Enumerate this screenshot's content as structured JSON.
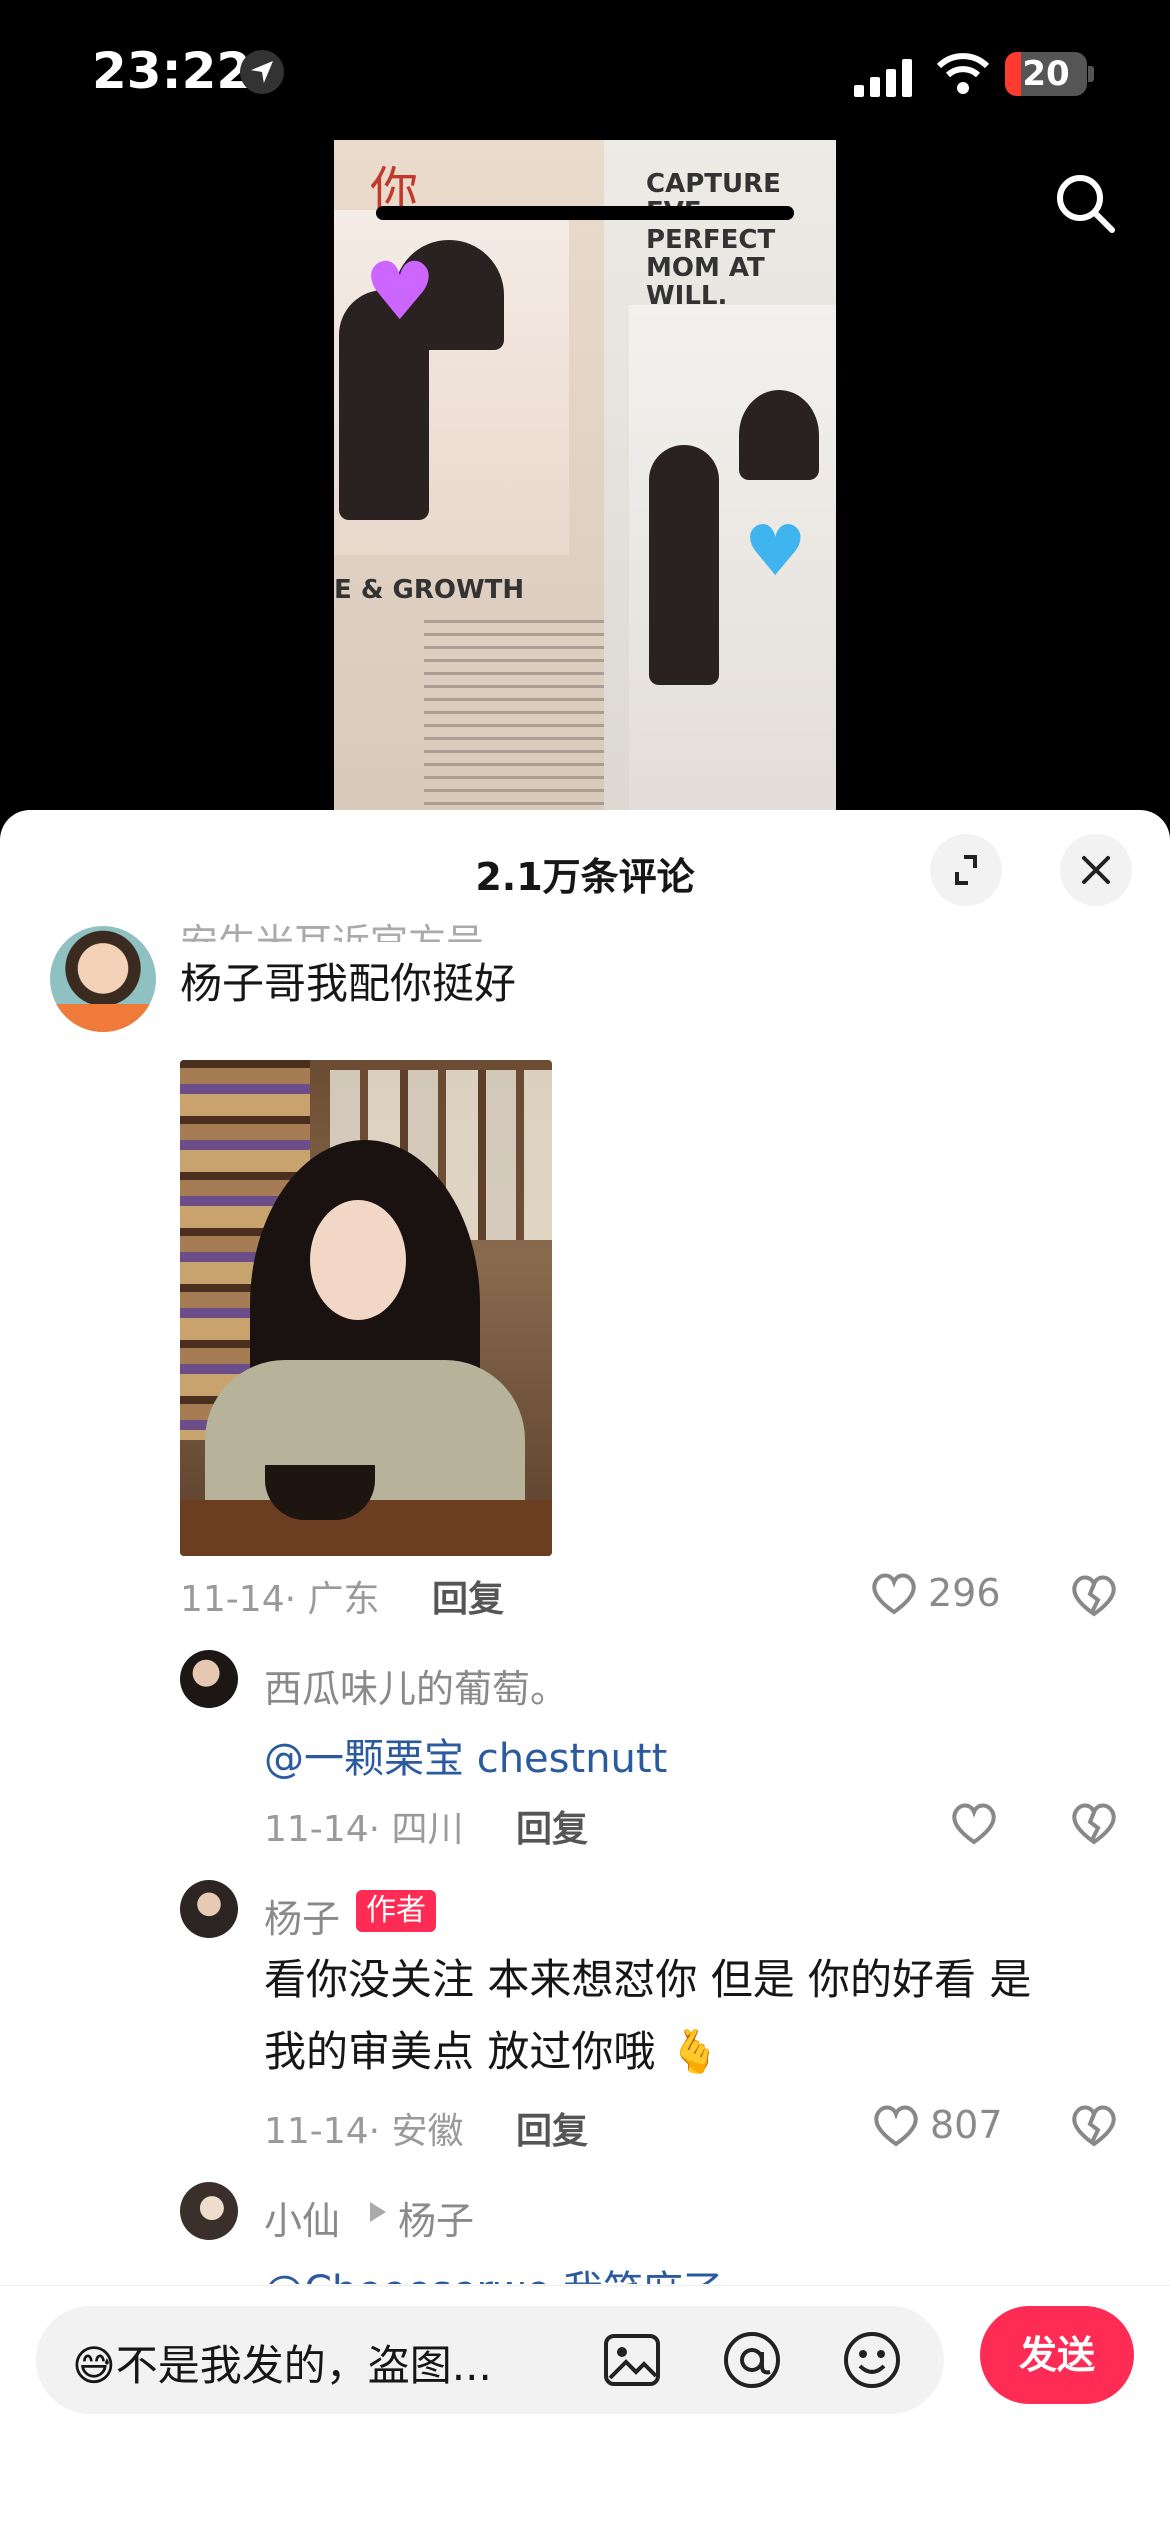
{
  "status_bar": {
    "time": "23:22",
    "battery": "20"
  },
  "video": {
    "text_right": "CAPTURE EVE PERFECT MOM AT WILL.",
    "text_left": "E & GROWTH",
    "text_top": "你"
  },
  "comments_sheet": {
    "title": "2.1万条评论",
    "main_comment": {
      "username_partial": "安生米耳近官方号",
      "text": "杨子哥我配你挺好",
      "date": "11-14",
      "location": "广东",
      "reply_label": "回复",
      "likes": "296"
    },
    "replies": [
      {
        "username": "西瓜味儿的葡萄。",
        "mention": "@一颗栗宝 chestnutt",
        "date": "11-14",
        "location": "四川",
        "reply_label": "回复",
        "likes": ""
      },
      {
        "username": "杨子",
        "badge": "作者",
        "text_line1": "看你没关注 本来想怼你 但是 你的好看 是",
        "text_line2": "我的审美点 放过你哦 🫰",
        "date": "11-14",
        "location": "安徽",
        "reply_label": "回复",
        "likes": "807"
      },
      {
        "username": "小仙",
        "reply_to": "杨子",
        "text_partial": "@Cheeeserwe 我笑麻了"
      }
    ]
  },
  "composer": {
    "input_text": "😅不是我发的，盗图...",
    "send_label": "发送"
  },
  "colors": {
    "accent": "#fe2c55",
    "mention": "#2b5b9e"
  }
}
